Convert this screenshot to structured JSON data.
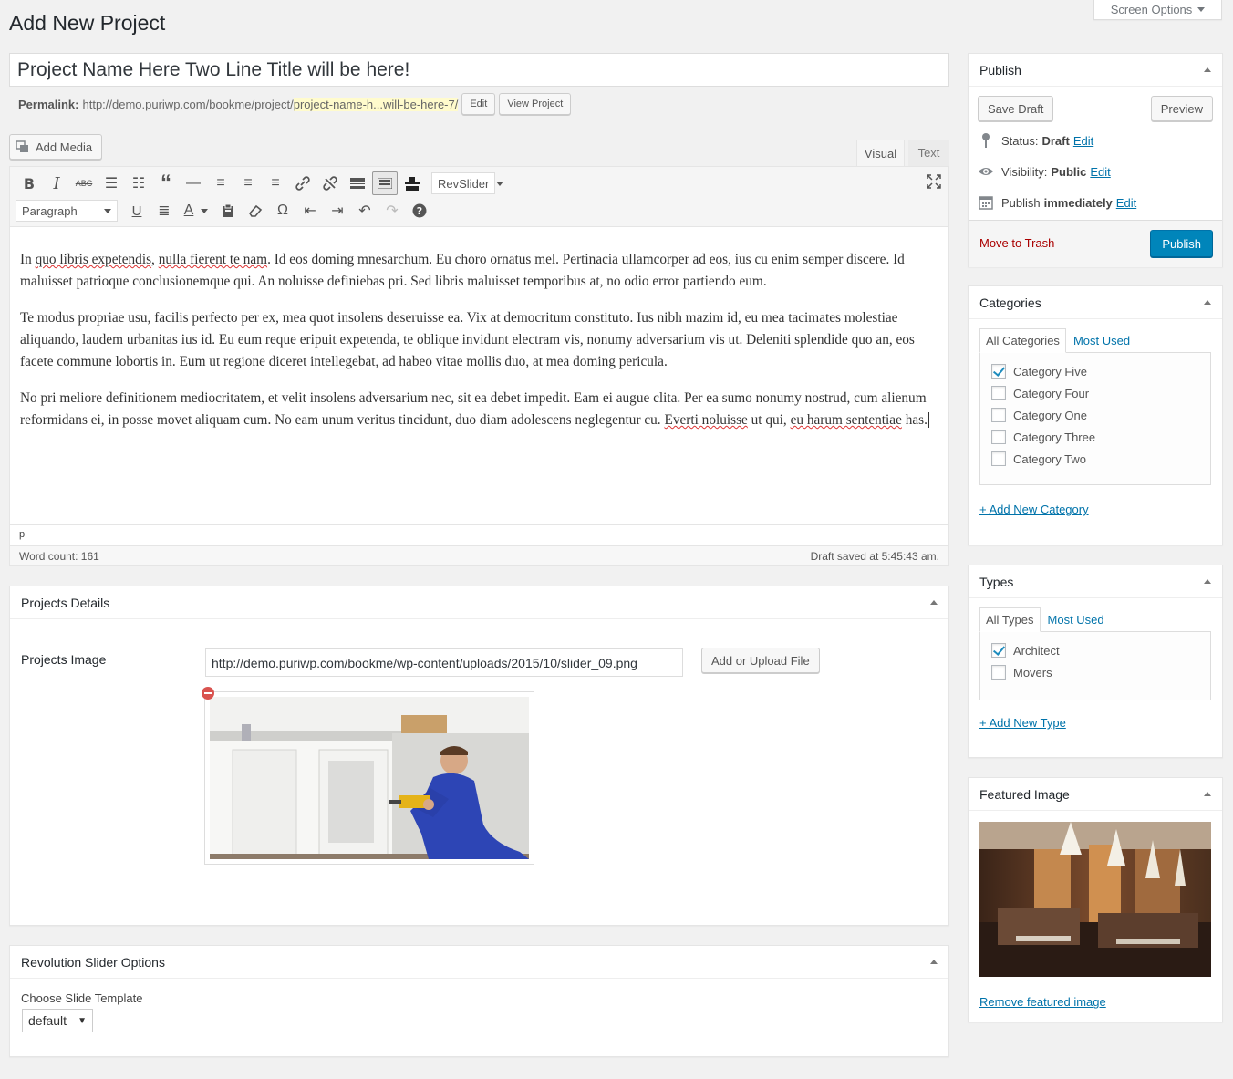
{
  "page": {
    "title": "Add New Project",
    "screen_options": "Screen Options"
  },
  "post": {
    "title": "Project Name Here Two Line Title will be here!",
    "permalink_label": "Permalink:",
    "permalink_base": "http://demo.puriwp.com/bookme/project/",
    "permalink_slug": "project-name-h...will-be-here-7/",
    "edit_label": "Edit",
    "view_label": "View Project"
  },
  "editor": {
    "add_media": "Add Media",
    "tab_visual": "Visual",
    "tab_text": "Text",
    "format_select": "Paragraph",
    "revslider_select": "RevSlider",
    "paragraphs": [
      [
        "quo",
        "libris",
        "expetendis",
        "nulla",
        "fierent",
        "te",
        "nam"
      ],
      "In quo libris expetendis, nulla fierent te nam. Id eos doming mnesarchum. Eu choro ornatus mel. Pertinacia ullamcorper ad eos, ius cu enim semper discere. Id maluisset patrioque conclusionemque qui. An noluisse definiebas pri. Sed libris maluisset temporibus at, no odio error partiendo eum.",
      "Te modus propriae usu, facilis perfecto per ex, mea quot insolens deseruisse ea. Vix at democritum constituto. Ius nibh mazim id, eu mea tacimates molestiae aliquando, laudem urbanitas ius id. Eu eum reque eripuit expetenda, te oblique invidunt electram vis, nonumy adversarium vis ut. Deleniti splendide quo an, eos facete commune lobortis in. Eum ut regione diceret intellegebat, ad habeo vitae mollis duo, at mea doming pericula.",
      "No pri meliore definitionem mediocritatem, et velit insolens adversarium nec, sit ea debet impedit. Eam ei augue clita. Per ea sumo nonumy nostrud, cum alienum reformidans ei, in posse movet aliquam cum. No eam unum veritus tincidunt, duo diam adolescens neglegentur cu. Everti noluisse ut qui, eu harum sententiae has."
    ],
    "p1_a": "In ",
    "p1_b": "quo libris expetendis",
    "p1_c": ", ",
    "p1_d": "nulla fierent te nam",
    "p1_e": ". Id eos doming mnesarchum. Eu choro ornatus mel. Pertinacia ullamcorper ad eos, ius cu enim semper discere. Id maluisset patrioque conclusionemque qui. An noluisse definiebas pri. Sed libris maluisset temporibus at, no odio error partiendo eum.",
    "p2": "Te modus propriae usu, facilis perfecto per ex, mea quot insolens deseruisse ea. Vix at democritum constituto. Ius nibh mazim id, eu mea tacimates molestiae aliquando, laudem urbanitas ius id. Eu eum reque eripuit expetenda, te oblique invidunt electram vis, nonumy adversarium vis ut. Deleniti splendide quo an, eos facete commune lobortis in. Eum ut regione diceret intellegebat, ad habeo vitae mollis duo, at mea doming pericula.",
    "p3_a": "No pri meliore definitionem mediocritatem, et velit insolens adversarium nec, sit ea debet impedit. Eam ei augue clita. Per ea sumo nonumy nostrud, cum alienum reformidans ei, in posse movet aliquam cum. No eam unum veritus tincidunt, duo diam adolescens neglegentur cu. ",
    "p3_b": "Everti noluisse",
    "p3_c": " ut qui, ",
    "p3_d": "eu harum sententiae",
    "p3_e": " has.",
    "path": "p",
    "word_count": "Word count: 161",
    "draft_saved": "Draft saved at 5:45:43 am."
  },
  "projects_details": {
    "title": "Projects Details",
    "image_label": "Projects Image",
    "image_url": "http://demo.puriwp.com/bookme/wp-content/uploads/2015/10/slider_09.png",
    "upload_button": "Add or Upload File"
  },
  "rev_slider": {
    "title": "Revolution Slider Options",
    "template_label": "Choose Slide Template",
    "template_value": "default"
  },
  "publish": {
    "title": "Publish",
    "save_draft": "Save Draft",
    "preview": "Preview",
    "status_label": "Status:",
    "status_value": "Draft",
    "visibility_label": "Visibility:",
    "visibility_value": "Public",
    "publish_label": "Publish",
    "publish_value": "immediately",
    "edit": "Edit",
    "trash": "Move to Trash",
    "publish_button": "Publish"
  },
  "categories": {
    "title": "Categories",
    "tab_all": "All Categories",
    "tab_most": "Most Used",
    "items": [
      {
        "label": "Category Five",
        "checked": true
      },
      {
        "label": "Category Four",
        "checked": false
      },
      {
        "label": "Category One",
        "checked": false
      },
      {
        "label": "Category Three",
        "checked": false
      },
      {
        "label": "Category Two",
        "checked": false
      }
    ],
    "add_new": "+ Add New Category"
  },
  "types": {
    "title": "Types",
    "tab_all": "All Types",
    "tab_most": "Most Used",
    "items": [
      {
        "label": "Architect",
        "checked": true
      },
      {
        "label": "Movers",
        "checked": false
      }
    ],
    "add_new": "+ Add New Type"
  },
  "featured": {
    "title": "Featured Image",
    "remove": "Remove featured image"
  },
  "colors": {
    "link": "#0073aa",
    "primary": "#0085ba",
    "trash": "#a00",
    "slug_highlight": "#fffbcc"
  }
}
